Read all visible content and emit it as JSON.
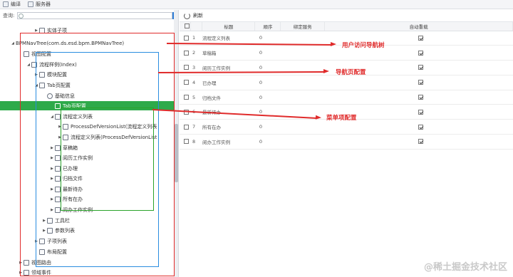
{
  "toolbar": {
    "edit_label": "编译",
    "server_label": "服务器"
  },
  "search": {
    "label": "查询:",
    "placeholder": "",
    "button_icon": "search-icon"
  },
  "tree": {
    "nodes": [
      {
        "label": "实体子项",
        "icon": "table-icon",
        "level": 5,
        "toggle": "▶"
      },
      {
        "label": "BPMNavTree(com.ds.esd.bpm.BPMNavTree)",
        "icon": "",
        "level": 2,
        "toggle": "◢"
      },
      {
        "label": "视图配置",
        "icon": "folder-icon",
        "level": 3,
        "toggle": ""
      },
      {
        "label": "流程样例(Index)",
        "icon": "tree-icon",
        "level": 4,
        "toggle": "◢"
      },
      {
        "label": "模块配置",
        "icon": "module-icon",
        "level": 5,
        "toggle": "▶"
      },
      {
        "label": "Tab页配置",
        "icon": "tab-icon",
        "level": 5,
        "toggle": "◢"
      },
      {
        "label": "基础信息",
        "icon": "gear-icon",
        "level": 6,
        "toggle": ""
      },
      {
        "label": "Tab页配置",
        "icon": "grid-icon",
        "level": 7,
        "toggle": ""
      },
      {
        "label": "流程定义列表",
        "icon": "flow-icon",
        "level": 7,
        "toggle": "◢"
      },
      {
        "label": "ProcessDefVersionList(流程定义列表",
        "icon": "flow-icon",
        "level": 8,
        "toggle": "▶"
      },
      {
        "label": "流程定义列表(ProcessDefVersionList",
        "icon": "table-icon",
        "level": 8,
        "toggle": "▶"
      },
      {
        "label": "草稿箱",
        "icon": "draft-icon",
        "level": 7,
        "toggle": "▶"
      },
      {
        "label": "阅历工作实例",
        "icon": "history-icon",
        "level": 7,
        "toggle": "▶"
      },
      {
        "label": "已办理",
        "icon": "done-icon",
        "level": 7,
        "toggle": "▶"
      },
      {
        "label": "归档文件",
        "icon": "archive-icon",
        "level": 7,
        "toggle": "▶"
      },
      {
        "label": "最新待办",
        "icon": "todo-icon",
        "level": 7,
        "toggle": "▶"
      },
      {
        "label": "所有在办",
        "icon": "all-icon",
        "level": 7,
        "toggle": "▶"
      },
      {
        "label": "阅办工作实例",
        "icon": "read-icon",
        "level": 7,
        "toggle": "▶"
      },
      {
        "label": "工具栏",
        "icon": "toolbar-icon",
        "level": 6,
        "toggle": "▶"
      },
      {
        "label": "参数列表",
        "icon": "param-icon",
        "level": 6,
        "toggle": "▶"
      },
      {
        "label": "子项列表",
        "icon": "grid-icon",
        "level": 5,
        "toggle": "▶"
      },
      {
        "label": "布局配置",
        "icon": "layout-icon",
        "level": 5,
        "toggle": ""
      },
      {
        "label": "视图路由",
        "icon": "route-icon",
        "level": 3,
        "toggle": "▶"
      },
      {
        "label": "领域事件",
        "icon": "event-icon",
        "level": 3,
        "toggle": "▶"
      }
    ],
    "selected_index": 7
  },
  "right": {
    "refresh_label": "刷新",
    "columns": [
      "标题",
      "顺序",
      "绑定服务",
      "自动重载"
    ],
    "rows": [
      {
        "idx": "1",
        "title": "流程定义列表",
        "order": "0",
        "service": "",
        "auto": true
      },
      {
        "idx": "2",
        "title": "草稿箱",
        "order": "0",
        "service": "",
        "auto": true
      },
      {
        "idx": "3",
        "title": "阅历工作实例",
        "order": "0",
        "service": "",
        "auto": true
      },
      {
        "idx": "4",
        "title": "已办理",
        "order": "0",
        "service": "",
        "auto": true
      },
      {
        "idx": "5",
        "title": "归档文件",
        "order": "0",
        "service": "",
        "auto": true
      },
      {
        "idx": "6",
        "title": "最新待办",
        "order": "0",
        "service": "",
        "auto": true
      },
      {
        "idx": "7",
        "title": "所有在办",
        "order": "0",
        "service": "",
        "auto": true
      },
      {
        "idx": "8",
        "title": "阅办工作实例",
        "order": "0",
        "service": "",
        "auto": true
      }
    ]
  },
  "annotations": [
    {
      "text": "用户访问导航树"
    },
    {
      "text": "导航页配置"
    },
    {
      "text": "菜单项配置"
    }
  ],
  "watermark": "@稀土掘金技术社区",
  "colors": {
    "accent": "#2eaa4a",
    "annotation": "#e02b2b",
    "blue_box": "#2a8de0",
    "green_box": "#2aa32a"
  }
}
